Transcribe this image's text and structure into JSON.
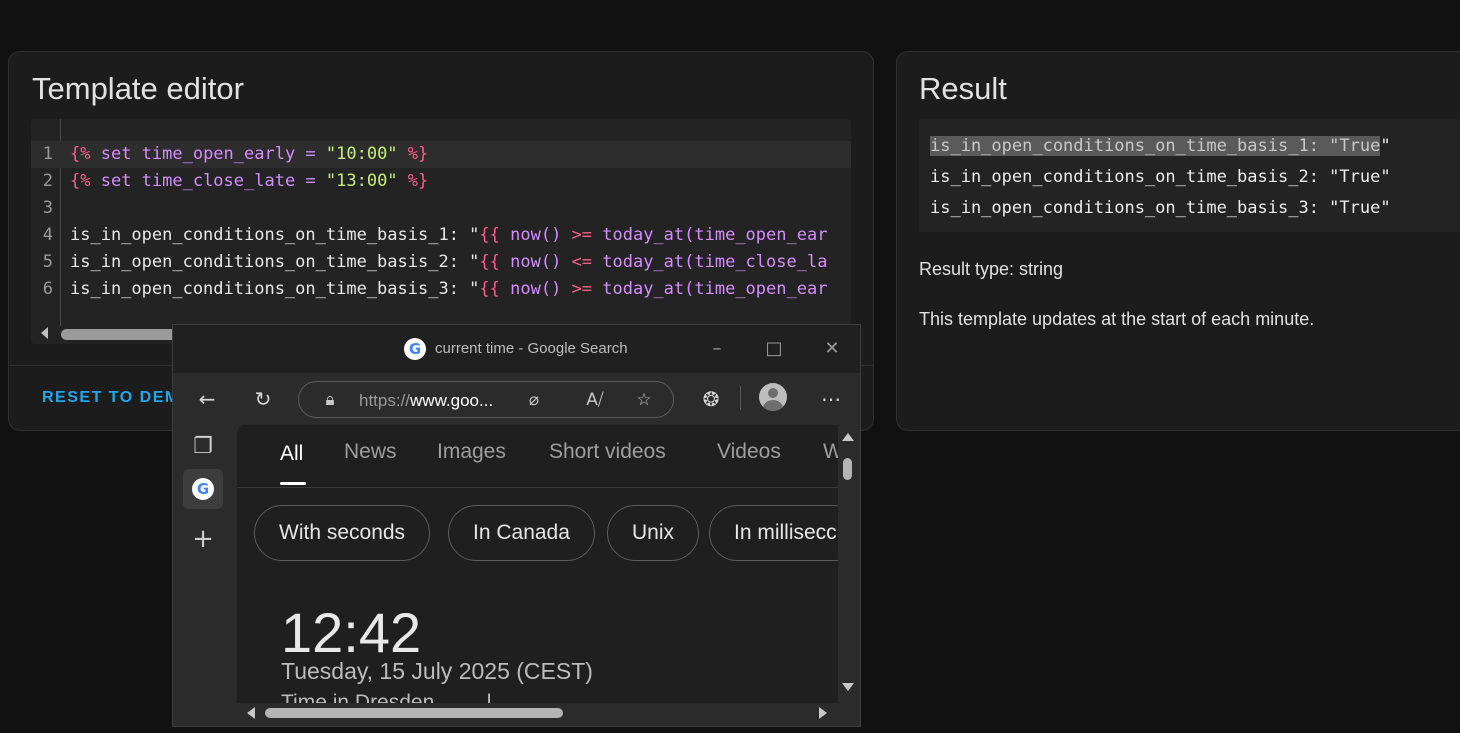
{
  "editor_card": {
    "title": "Template editor",
    "lines": [
      {
        "num": "1",
        "parts": [
          [
            "kw",
            "{%"
          ],
          [
            "tag",
            " set time_open_early = "
          ],
          [
            "str",
            "\"10:00\""
          ],
          [
            "kw",
            " %}"
          ]
        ]
      },
      {
        "num": "2",
        "parts": [
          [
            "kw",
            "{%"
          ],
          [
            "tag",
            " set time_close_late = "
          ],
          [
            "str",
            "\"13:00\""
          ],
          [
            "kw",
            " %}"
          ]
        ]
      },
      {
        "num": "3",
        "parts": []
      },
      {
        "num": "4",
        "parts": [
          [
            "",
            "is_in_open_conditions_on_time_basis_1: \""
          ],
          [
            "kw",
            "{{"
          ],
          [
            "tag",
            " now() "
          ],
          [
            "kw",
            ">="
          ],
          [
            "tag",
            " today_at(time_open_ear"
          ]
        ]
      },
      {
        "num": "5",
        "parts": [
          [
            "",
            "is_in_open_conditions_on_time_basis_2: \""
          ],
          [
            "kw",
            "{{"
          ],
          [
            "tag",
            " now() "
          ],
          [
            "kw",
            "<="
          ],
          [
            "tag",
            " today_at(time_close_la"
          ]
        ]
      },
      {
        "num": "6",
        "parts": [
          [
            "",
            "is_in_open_conditions_on_time_basis_3: \""
          ],
          [
            "kw",
            "{{"
          ],
          [
            "tag",
            " now() "
          ],
          [
            "kw",
            ">="
          ],
          [
            "tag",
            " today_at(time_open_ear"
          ]
        ]
      }
    ],
    "reset_label": "RESET TO DEM"
  },
  "result_card": {
    "title": "Result",
    "line1_highlighted": "is_in_open_conditions_on_time_basis_1: \"True",
    "line1_rest": "\"",
    "line2": "is_in_open_conditions_on_time_basis_2: \"True\"",
    "line3": "is_in_open_conditions_on_time_basis_3: \"True\"",
    "result_type": "Result type: string",
    "update_note": "This template updates at the start of each minute."
  },
  "browser": {
    "window_title": "current time - Google Search",
    "address_scheme": "https://",
    "address_host": "www.goo...",
    "tabs": [
      "All",
      "News",
      "Images",
      "Short videos",
      "Videos",
      "W"
    ],
    "chips": [
      "With seconds",
      "In Canada",
      "Unix",
      "In millisecc"
    ],
    "clock": "12:42",
    "date": "Tuesday, 15 July 2025 (CEST)",
    "more_text": "Time in Dresden, ...  ...l..."
  }
}
